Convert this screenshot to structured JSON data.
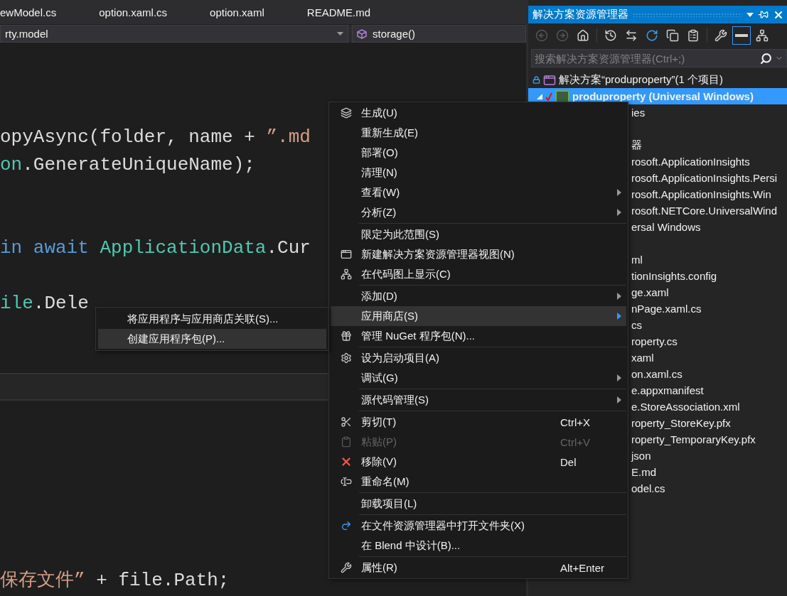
{
  "editor": {
    "tabs": [
      {
        "label": "ewModel.cs",
        "selected": false
      },
      {
        "label": "option.xaml.cs",
        "selected": false
      },
      {
        "label": "option.xaml",
        "selected": false
      },
      {
        "label": "README.md",
        "selected": false
      }
    ],
    "nav": {
      "scope": "rty.model",
      "member": "storage()"
    },
    "lines": [
      {
        "kind": "code",
        "tokens": [
          {
            "text": "opyAsync(folder, name + ",
            "kind": "plain"
          },
          {
            "text": "”.md",
            "kind": "string"
          }
        ]
      },
      {
        "kind": "code",
        "tokens": [
          {
            "text": "on",
            "kind": "type"
          },
          {
            "text": ".GenerateUniqueName);",
            "kind": "plain"
          }
        ]
      },
      {
        "kind": "blank"
      },
      {
        "kind": "blank"
      },
      {
        "kind": "code",
        "tokens": [
          {
            "text": "in await ",
            "kind": "keyword"
          },
          {
            "text": "ApplicationData",
            "kind": "type"
          },
          {
            "text": ".Cur",
            "kind": "plain"
          }
        ]
      },
      {
        "kind": "blank"
      },
      {
        "kind": "code",
        "tokens": [
          {
            "text": "ile",
            "kind": "type"
          },
          {
            "text": ".Dele",
            "kind": "plain"
          }
        ]
      },
      {
        "kind": "blank"
      },
      {
        "kind": "blank"
      },
      {
        "kind": "current"
      },
      {
        "kind": "blank"
      },
      {
        "kind": "blank"
      },
      {
        "kind": "blank"
      },
      {
        "kind": "blank"
      },
      {
        "kind": "blank"
      },
      {
        "kind": "blank"
      },
      {
        "kind": "code",
        "tokens": [
          {
            "text": "保存文件”",
            "kind": "string"
          },
          {
            "text": " + file.Path;",
            "kind": "plain"
          }
        ]
      }
    ]
  },
  "context_menu": [
    {
      "kind": "item",
      "label": "生成(U)",
      "submenu": false,
      "disabled": false,
      "selected": false
    },
    {
      "kind": "item",
      "label": "重新生成(E)",
      "submenu": false,
      "disabled": false,
      "selected": false
    },
    {
      "kind": "item",
      "label": "部署(O)",
      "submenu": false,
      "disabled": false,
      "selected": false
    },
    {
      "kind": "item",
      "label": "清理(N)",
      "submenu": false,
      "disabled": false,
      "selected": false
    },
    {
      "kind": "item",
      "label": "查看(W)",
      "submenu": true,
      "disabled": false,
      "selected": false
    },
    {
      "kind": "item",
      "label": "分析(Z)",
      "submenu": true,
      "disabled": false,
      "selected": false
    },
    {
      "kind": "separator"
    },
    {
      "kind": "item",
      "label": "限定为此范围(S)",
      "submenu": false,
      "disabled": false,
      "selected": false
    },
    {
      "kind": "item",
      "label": "新建解决方案资源管理器视图(N)",
      "submenu": false,
      "disabled": false,
      "selected": false
    },
    {
      "kind": "item",
      "label": "在代码图上显示(C)",
      "submenu": false,
      "disabled": false,
      "selected": false
    },
    {
      "kind": "separator"
    },
    {
      "kind": "item",
      "label": "添加(D)",
      "submenu": true,
      "disabled": false,
      "selected": false
    },
    {
      "kind": "item",
      "label": "应用商店(S)",
      "submenu": true,
      "disabled": false,
      "selected": true
    },
    {
      "kind": "item",
      "label": "管理 NuGet 程序包(N)...",
      "submenu": false,
      "disabled": false,
      "selected": false
    },
    {
      "kind": "separator"
    },
    {
      "kind": "item",
      "label": "设为启动项目(A)",
      "submenu": false,
      "disabled": false,
      "selected": false
    },
    {
      "kind": "item",
      "label": "调试(G)",
      "submenu": true,
      "disabled": false,
      "selected": false
    },
    {
      "kind": "separator"
    },
    {
      "kind": "item",
      "label": "源代码管理(S)",
      "submenu": true,
      "disabled": false,
      "selected": false
    },
    {
      "kind": "separator"
    },
    {
      "kind": "item",
      "label": "剪切(T)",
      "shortcut": "Ctrl+X",
      "submenu": false,
      "disabled": false,
      "selected": false
    },
    {
      "kind": "item",
      "label": "粘贴(P)",
      "shortcut": "Ctrl+V",
      "submenu": false,
      "disabled": true,
      "selected": false
    },
    {
      "kind": "item",
      "label": "移除(V)",
      "shortcut": "Del",
      "submenu": false,
      "disabled": false,
      "selected": false
    },
    {
      "kind": "item",
      "label": "重命名(M)",
      "submenu": false,
      "disabled": false,
      "selected": false
    },
    {
      "kind": "separator"
    },
    {
      "kind": "item",
      "label": "卸载项目(L)",
      "submenu": false,
      "disabled": false,
      "selected": false
    },
    {
      "kind": "separator"
    },
    {
      "kind": "item",
      "label": "在文件资源管理器中打开文件夹(X)",
      "submenu": false,
      "disabled": false,
      "selected": false
    },
    {
      "kind": "item",
      "label": "在 Blend 中设计(B)...",
      "submenu": false,
      "disabled": false,
      "selected": false
    },
    {
      "kind": "separator"
    },
    {
      "kind": "item",
      "label": "属性(R)",
      "shortcut": "Alt+Enter",
      "submenu": false,
      "disabled": false,
      "selected": false
    }
  ],
  "submenu": [
    {
      "label": "将应用程序与应用商店关联(S)...",
      "selected": false
    },
    {
      "label": "创建应用程序包(P)...",
      "selected": true
    }
  ],
  "solution_explorer": {
    "title": "解决方案资源管理器",
    "toolbar": [
      {
        "disabled": true,
        "selected": false
      },
      {
        "disabled": true,
        "selected": false
      },
      {
        "disabled": false,
        "selected": false
      },
      {
        "disabled": false,
        "selected": false
      },
      {
        "disabled": false,
        "selected": false
      },
      {
        "disabled": false,
        "selected": false
      },
      {
        "disabled": false,
        "selected": false
      },
      {
        "disabled": false,
        "selected": false
      },
      {
        "disabled": false,
        "selected": false
      },
      {
        "disabled": false,
        "selected": true
      },
      {
        "disabled": false,
        "selected": false
      }
    ],
    "search": {
      "placeholder": "搜索解决方案资源管理器(Ctrl+;)"
    },
    "solution": {
      "label": "解决方案“produproperty”(1 个项目)",
      "selected": false
    },
    "project": {
      "label": "produproperty (Universal Windows)",
      "selected": true,
      "expanded": true,
      "children": [
        {
          "kind": "file",
          "label": "ies"
        },
        {
          "kind": "covered",
          "children": [
            {
              "kind": "file",
              "label": "器"
            },
            {
              "kind": "file",
              "label": "rosoft.ApplicationInsights"
            },
            {
              "kind": "file",
              "label": "rosoft.ApplicationInsights.Persi"
            },
            {
              "kind": "file",
              "label": "rosoft.ApplicationInsights.Win"
            },
            {
              "kind": "file",
              "label": "rosoft.NETCore.UniversalWind"
            },
            {
              "kind": "file",
              "label": "ersal Windows"
            }
          ]
        },
        {
          "kind": "covered"
        },
        {
          "kind": "file",
          "label": "ml"
        },
        {
          "kind": "file",
          "label": "tionInsights.config"
        },
        {
          "kind": "file",
          "label": "ge.xaml"
        },
        {
          "kind": "file",
          "label": "nPage.xaml.cs"
        },
        {
          "kind": "file",
          "label": "cs"
        },
        {
          "kind": "file",
          "label": "roperty.cs"
        },
        {
          "kind": "file",
          "label": "xaml"
        },
        {
          "kind": "file",
          "label": "on.xaml.cs"
        },
        {
          "kind": "file",
          "label": "e.appxmanifest"
        },
        {
          "kind": "file",
          "label": "e.StoreAssociation.xml"
        },
        {
          "kind": "file",
          "label": "roperty_StoreKey.pfx"
        },
        {
          "kind": "file",
          "label": "roperty_TemporaryKey.pfx"
        },
        {
          "kind": "file",
          "label": "json"
        },
        {
          "kind": "file",
          "label": "E.md"
        },
        {
          "kind": "file",
          "label": "odel.cs"
        }
      ]
    }
  }
}
